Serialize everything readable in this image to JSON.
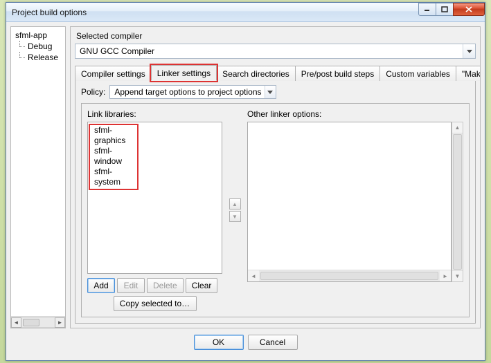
{
  "window": {
    "title": "Project build options"
  },
  "tree": {
    "root": "sfml-app",
    "children": [
      "Debug",
      "Release"
    ]
  },
  "right": {
    "selected_label": "Selected compiler",
    "compiler": "GNU GCC Compiler"
  },
  "tabs": {
    "items": [
      "Compiler settings",
      "Linker settings",
      "Search directories",
      "Pre/post build steps",
      "Custom variables",
      "\"Make\" commands"
    ],
    "active_index": 1
  },
  "policy": {
    "label": "Policy:",
    "value": "Append target options to project options"
  },
  "link": {
    "libs_label": "Link libraries:",
    "libs": [
      "sfml-graphics",
      "sfml-window",
      "sfml-system"
    ],
    "other_label": "Other linker options:"
  },
  "buttons": {
    "add": "Add",
    "edit": "Edit",
    "delete": "Delete",
    "clear": "Clear",
    "copy_selected": "Copy selected to…"
  },
  "footer": {
    "ok": "OK",
    "cancel": "Cancel"
  }
}
